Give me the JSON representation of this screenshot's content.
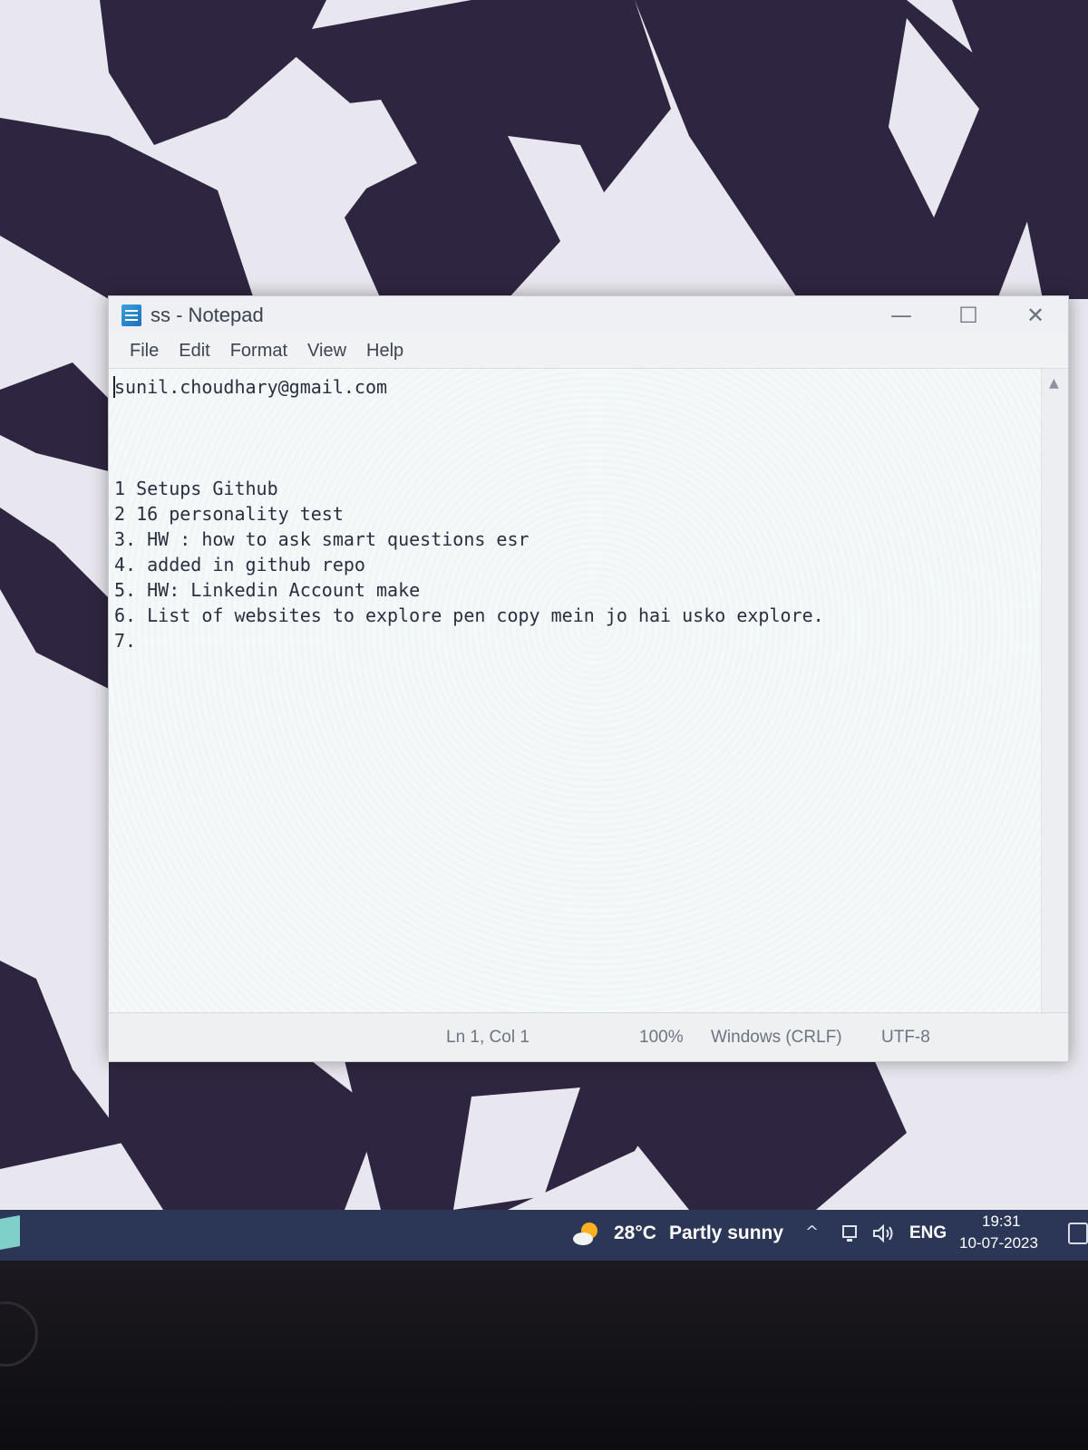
{
  "window": {
    "title": "ss - Notepad",
    "icon": "notepad-icon",
    "controls": {
      "minimize": "—",
      "maximize": "☐",
      "close": "✕"
    }
  },
  "menu": {
    "items": [
      "File",
      "Edit",
      "Format",
      "View",
      "Help"
    ]
  },
  "editor": {
    "lines": [
      "sunil.choudhary@gmail.com",
      "1 Setups Github",
      "2 16 personality test",
      "3. HW : how to ask smart questions esr",
      "4. added in github repo",
      "5. HW: Linkedin Account make",
      "6. List of websites to explore pen copy mein jo hai usko explore.",
      "7."
    ]
  },
  "status": {
    "position": "Ln 1, Col 1",
    "zoom": "100%",
    "line_ending": "Windows (CRLF)",
    "encoding": "UTF-8"
  },
  "taskbar": {
    "weather_temp": "28°C",
    "weather_desc": "Partly sunny",
    "weather_icon": "partly-sunny-icon",
    "language": "ENG",
    "time": "19:31",
    "date": "10-07-2023"
  },
  "colors": {
    "taskbar": "#2c3656",
    "wallpaper_dark": "#2e2640",
    "wallpaper_light": "#e8e6ee"
  }
}
